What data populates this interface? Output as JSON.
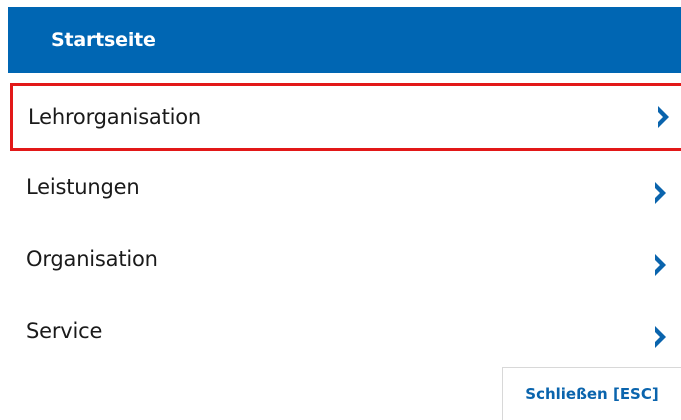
{
  "header": {
    "title": "Startseite"
  },
  "menu": {
    "items": [
      {
        "label": "Lehrorganisation",
        "icon": "chevron-right-icon"
      },
      {
        "label": "Leistungen",
        "icon": "chevron-right-icon"
      },
      {
        "label": "Organisation",
        "icon": "chevron-right-icon"
      },
      {
        "label": "Service",
        "icon": "chevron-right-icon"
      }
    ]
  },
  "footer": {
    "close_label": "Schließen [ESC]"
  },
  "colors": {
    "header_bg": "#0066b3",
    "header_text": "#ffffff",
    "chevron": "#0a64ad",
    "highlight_border": "#e21818",
    "close_text": "#0a64ad"
  }
}
